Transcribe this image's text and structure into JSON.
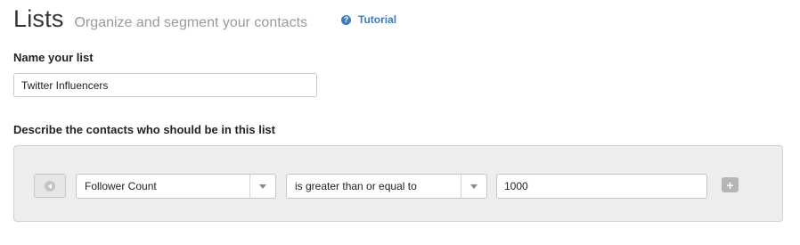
{
  "header": {
    "title": "Lists",
    "subtitle": "Organize and segment your contacts",
    "tutorial_label": "Tutorial",
    "tutorial_icon": "help-circle-icon",
    "accent_color": "#3b7cc4"
  },
  "name_section": {
    "label": "Name your list",
    "value": "Twitter Influencers"
  },
  "describe_section": {
    "label": "Describe the contacts who should be in this list"
  },
  "rule": {
    "remove_icon": "remove-rule-icon",
    "field": "Follower Count",
    "operator": "is greater than or equal to",
    "value": "1000",
    "add_icon": "plus-icon"
  }
}
